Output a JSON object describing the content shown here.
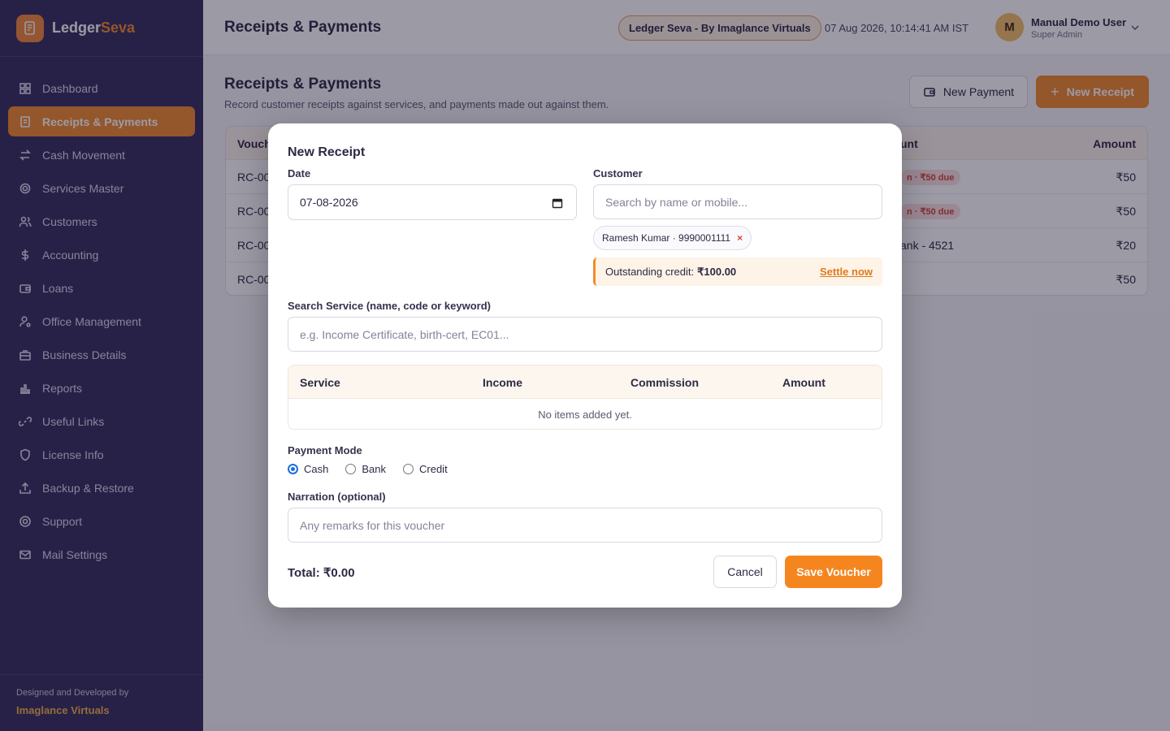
{
  "brand": {
    "name_part1": "Ledger",
    "name_part2": "Seva"
  },
  "sidebar": {
    "items": [
      {
        "label": "Dashboard",
        "icon": "dashboard-icon"
      },
      {
        "label": "Receipts & Payments",
        "icon": "receipt-icon",
        "active": true
      },
      {
        "label": "Cash Movement",
        "icon": "swap-icon"
      },
      {
        "label": "Services Master",
        "icon": "gear-icon"
      },
      {
        "label": "Customers",
        "icon": "users-icon"
      },
      {
        "label": "Accounting",
        "icon": "dollar-icon"
      },
      {
        "label": "Loans",
        "icon": "wallet-icon"
      },
      {
        "label": "Office Management",
        "icon": "user-cog-icon"
      },
      {
        "label": "Business Details",
        "icon": "briefcase-icon"
      },
      {
        "label": "Reports",
        "icon": "chart-icon"
      },
      {
        "label": "Useful Links",
        "icon": "link-icon"
      },
      {
        "label": "License Info",
        "icon": "shield-icon"
      },
      {
        "label": "Backup & Restore",
        "icon": "upload-icon"
      },
      {
        "label": "Support",
        "icon": "support-icon"
      },
      {
        "label": "Mail Settings",
        "icon": "mail-icon"
      }
    ],
    "footer_line1": "Designed and Developed by",
    "footer_line2": "Imaglance Virtuals"
  },
  "header": {
    "title": "Receipts & Payments",
    "pill": "Ledger Seva - By Imaglance Virtuals",
    "datetime": "07 Aug 2026, 10:14:41 AM IST",
    "avatar_letter": "M",
    "user_name": "Manual Demo User",
    "user_role": "Super Admin"
  },
  "page": {
    "title": "Receipts & Payments",
    "subtitle": "Record customer receipts against services, and payments made out against them.",
    "new_payment": "New Payment",
    "new_receipt": "New Receipt"
  },
  "table": {
    "columns": {
      "voucher": "Vouch",
      "mode": "unt",
      "amount": "Amount"
    },
    "rows": [
      {
        "voucher": "RC-00",
        "mode": "n · ₹50 due",
        "mode_type": "badge",
        "amount": "₹50"
      },
      {
        "voucher": "RC-00",
        "mode": "n · ₹50 due",
        "mode_type": "badge",
        "amount": "₹50"
      },
      {
        "voucher": "RC-00",
        "mode": "ank - 4521",
        "mode_type": "text",
        "amount": "₹20"
      },
      {
        "voucher": "RC-00",
        "mode": "",
        "mode_type": "text",
        "amount": "₹50"
      }
    ]
  },
  "modal": {
    "title": "New Receipt",
    "date_label": "Date",
    "date_value": "07-08-2026",
    "customer_label": "Customer",
    "customer_placeholder": "Search by name or mobile...",
    "chip": "Ramesh Kumar · 9990001111",
    "chip_close": "×",
    "credit_label": "Outstanding credit:",
    "credit_value": "₹100.00",
    "settle": "Settle now",
    "service_label": "Search Service (name, code or keyword)",
    "service_placeholder": "e.g. Income Certificate, birth-cert, EC01...",
    "items_columns": {
      "service": "Service",
      "income": "Income",
      "commission": "Commission",
      "amount": "Amount"
    },
    "empty_text": "No items added yet.",
    "payment_mode_label": "Payment Mode",
    "modes": {
      "cash": "Cash",
      "bank": "Bank",
      "credit": "Credit"
    },
    "selected_mode": "Cash",
    "narration_label": "Narration (optional)",
    "narration_placeholder": "Any remarks for this voucher",
    "total": "Total: ₹0.00",
    "cancel": "Cancel",
    "save": "Save Voucher"
  },
  "colors": {
    "accent": "#f28a2e",
    "sidebar": "#37305d",
    "danger": "#d0453a"
  }
}
